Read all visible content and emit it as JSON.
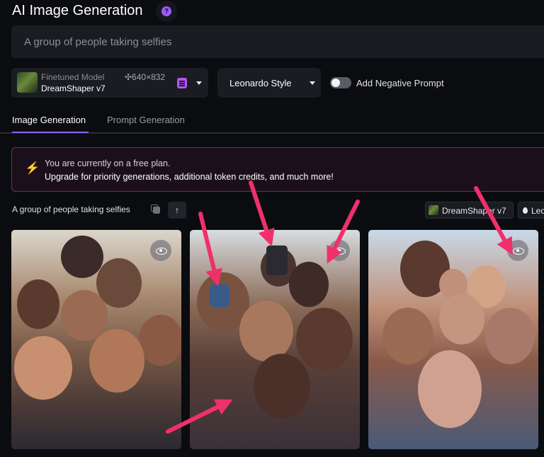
{
  "header": {
    "title": "AI Image Generation",
    "help_icon": "?"
  },
  "prompt": {
    "text": "A group of people taking selfies"
  },
  "model": {
    "label": "Finetuned Model",
    "name": "DreamShaper v7",
    "dimensions": "✣640×832"
  },
  "style": {
    "label": "Leonardo Style"
  },
  "negative_prompt": {
    "label": "Add Negative Prompt",
    "enabled": false
  },
  "tabs": [
    {
      "label": "Image Generation",
      "active": true
    },
    {
      "label": "Prompt Generation",
      "active": false
    }
  ],
  "banner": {
    "icon": "⚡",
    "line1": "You are currently on a free plan.",
    "line2": "Upgrade for priority generations, additional token credits, and much more!"
  },
  "generation": {
    "prompt": "A group of people taking selfies",
    "upload_icon": "↑",
    "model_chip": "DreamShaper v7",
    "style_chip": "Leo"
  },
  "colors": {
    "accent": "#8b5cf6",
    "arrow": "#f0306a",
    "banner_border": "#7a2860"
  }
}
